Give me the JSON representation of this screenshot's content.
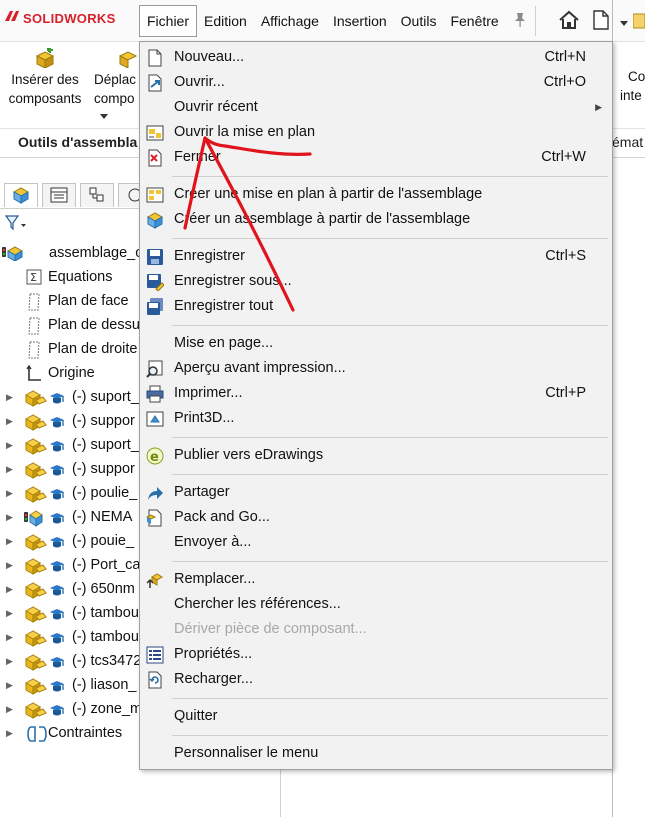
{
  "app": {
    "logo_text": "SOLIDWORKS",
    "brand_color": "#d8202a"
  },
  "menubar": [
    "Fichier",
    "Edition",
    "Affichage",
    "Insertion",
    "Outils",
    "Fenêtre"
  ],
  "commands": {
    "insert_components": "Insérer des composants",
    "insert_components_l1": "Insérer des",
    "insert_components_l2": "composants",
    "move_l1": "Déplac",
    "move_l2": "compo",
    "right_l1": "Co",
    "right_l2": "inte",
    "tab_assembly": "Outils d'assembla",
    "tab_right": "émat"
  },
  "tree": [
    {
      "label": "assemblage_c",
      "icon": "assembly-icon",
      "expand": false,
      "indent": 0
    },
    {
      "label": "Equations",
      "icon": "equations-icon",
      "expand": false,
      "indent": 1
    },
    {
      "label": "Plan de face",
      "icon": "plane-icon",
      "expand": false,
      "indent": 1
    },
    {
      "label": "Plan de dessu",
      "icon": "plane-icon",
      "expand": false,
      "indent": 1
    },
    {
      "label": "Plan de droite",
      "icon": "plane-icon",
      "expand": false,
      "indent": 1
    },
    {
      "label": "Origine",
      "icon": "origin-icon",
      "expand": false,
      "indent": 1
    },
    {
      "label": "(-) suport_",
      "icon": "part-icon",
      "expand": true,
      "indent": 1
    },
    {
      "label": "(-) suppor",
      "icon": "part-icon",
      "expand": true,
      "indent": 1
    },
    {
      "label": "(-) suport_",
      "icon": "part-icon",
      "expand": true,
      "indent": 1
    },
    {
      "label": "(-) suppor",
      "icon": "part-icon",
      "expand": true,
      "indent": 1
    },
    {
      "label": "(-) poulie_",
      "icon": "part-icon",
      "expand": true,
      "indent": 1
    },
    {
      "label": "(-) NEMA",
      "icon": "subassembly-icon",
      "expand": true,
      "indent": 1
    },
    {
      "label": "(-) pouie_",
      "icon": "part-icon",
      "expand": true,
      "indent": 1
    },
    {
      "label": "(-) Port_ca",
      "icon": "part-icon",
      "expand": true,
      "indent": 1
    },
    {
      "label": "(-) 650nm",
      "icon": "part-icon",
      "expand": true,
      "indent": 1
    },
    {
      "label": "(-) tambou",
      "icon": "part-icon",
      "expand": true,
      "indent": 1
    },
    {
      "label": "(-) tambou",
      "icon": "part-icon",
      "expand": true,
      "indent": 1
    },
    {
      "label": "(-) tcs3472",
      "icon": "part-icon",
      "expand": true,
      "indent": 1
    },
    {
      "label": "(-) liason_",
      "icon": "part-icon",
      "expand": true,
      "indent": 1
    },
    {
      "label": "(-) zone_m",
      "icon": "part-icon",
      "expand": true,
      "indent": 1
    },
    {
      "label": "Contraintes",
      "icon": "mates-icon",
      "expand": true,
      "indent": 1
    }
  ],
  "menu": {
    "items": [
      {
        "label": "Nouveau...",
        "shortcut": "Ctrl+N",
        "icon": "new-document-icon"
      },
      {
        "label": "Ouvrir...",
        "shortcut": "Ctrl+O",
        "icon": "open-folder-icon"
      },
      {
        "label": "Ouvrir récent",
        "shortcut": "",
        "icon": "",
        "submenu": true
      },
      {
        "label": "Ouvrir la mise en plan",
        "shortcut": "",
        "icon": "open-drawing-icon"
      },
      {
        "label": "Fermer",
        "shortcut": "Ctrl+W",
        "icon": "close-document-icon"
      },
      {
        "label": "Créer une mise en plan à partir de l'assemblage",
        "shortcut": "",
        "icon": "make-drawing-icon"
      },
      {
        "label": "Créer un assemblage à partir de l'assemblage",
        "shortcut": "",
        "icon": "make-assembly-icon"
      },
      {
        "label": "Enregistrer",
        "shortcut": "Ctrl+S",
        "icon": "save-icon"
      },
      {
        "label": "Enregistrer sous...",
        "shortcut": "",
        "icon": "save-as-icon"
      },
      {
        "label": "Enregistrer tout",
        "shortcut": "",
        "icon": "save-all-icon"
      },
      {
        "label": "Mise en page...",
        "shortcut": "",
        "icon": ""
      },
      {
        "label": "Aperçu avant impression...",
        "shortcut": "",
        "icon": "print-preview-icon"
      },
      {
        "label": "Imprimer...",
        "shortcut": "Ctrl+P",
        "icon": "printer-icon"
      },
      {
        "label": "Print3D...",
        "shortcut": "",
        "icon": "print3d-icon"
      },
      {
        "label": "Publier vers eDrawings",
        "shortcut": "",
        "icon": "edrawings-icon"
      },
      {
        "label": "Partager",
        "shortcut": "",
        "icon": "share-icon"
      },
      {
        "label": "Pack and Go...",
        "shortcut": "",
        "icon": "pack-and-go-icon"
      },
      {
        "label": "Envoyer à...",
        "shortcut": "",
        "icon": ""
      },
      {
        "label": "Remplacer...",
        "shortcut": "",
        "icon": "replace-icon"
      },
      {
        "label": "Chercher les références...",
        "shortcut": "",
        "icon": ""
      },
      {
        "label": "Dériver pièce de composant...",
        "shortcut": "",
        "icon": "",
        "disabled": true
      },
      {
        "label": "Propriétés...",
        "shortcut": "",
        "icon": "properties-icon"
      },
      {
        "label": "Recharger...",
        "shortcut": "",
        "icon": "reload-icon"
      },
      {
        "label": "Quitter",
        "shortcut": "",
        "icon": ""
      },
      {
        "label": "Personnaliser le menu",
        "shortcut": "",
        "icon": ""
      }
    ]
  },
  "annotation_color": "#e0141c"
}
